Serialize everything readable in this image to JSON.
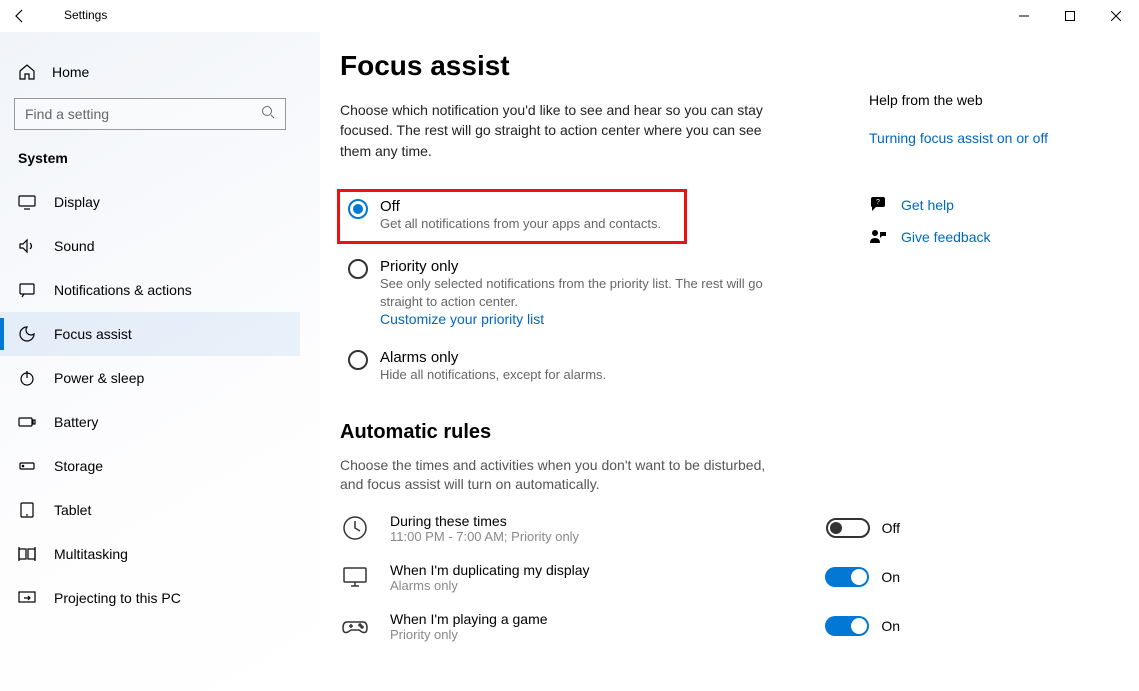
{
  "window": {
    "title": "Settings"
  },
  "sidebar": {
    "home": "Home",
    "search_placeholder": "Find a setting",
    "section": "System",
    "items": [
      {
        "label": "Display"
      },
      {
        "label": "Sound"
      },
      {
        "label": "Notifications & actions"
      },
      {
        "label": "Focus assist"
      },
      {
        "label": "Power & sleep"
      },
      {
        "label": "Battery"
      },
      {
        "label": "Storage"
      },
      {
        "label": "Tablet"
      },
      {
        "label": "Multitasking"
      },
      {
        "label": "Projecting to this PC"
      }
    ]
  },
  "page": {
    "title": "Focus assist",
    "desc": "Choose which notification you'd like to see and hear so you can stay focused. The rest will go straight to action center where you can see them any time.",
    "radios": [
      {
        "label": "Off",
        "sub": "Get all notifications from your apps and contacts."
      },
      {
        "label": "Priority only",
        "sub": "See only selected notifications from the priority list. The rest will go straight to action center.",
        "link": "Customize your priority list"
      },
      {
        "label": "Alarms only",
        "sub": "Hide all notifications, except for alarms."
      }
    ],
    "rules_heading": "Automatic rules",
    "rules_desc": "Choose the times and activities when you don't want to be disturbed, and focus assist will turn on automatically.",
    "rules": [
      {
        "title": "During these times",
        "sub": "11:00 PM - 7:00 AM; Priority only",
        "state": "Off",
        "on": false
      },
      {
        "title": "When I'm duplicating my display",
        "sub": "Alarms only",
        "state": "On",
        "on": true
      },
      {
        "title": "When I'm playing a game",
        "sub": "Priority only",
        "state": "On",
        "on": true
      }
    ]
  },
  "right": {
    "heading": "Help from the web",
    "link1": "Turning focus assist on or off",
    "help": "Get help",
    "feedback": "Give feedback"
  }
}
